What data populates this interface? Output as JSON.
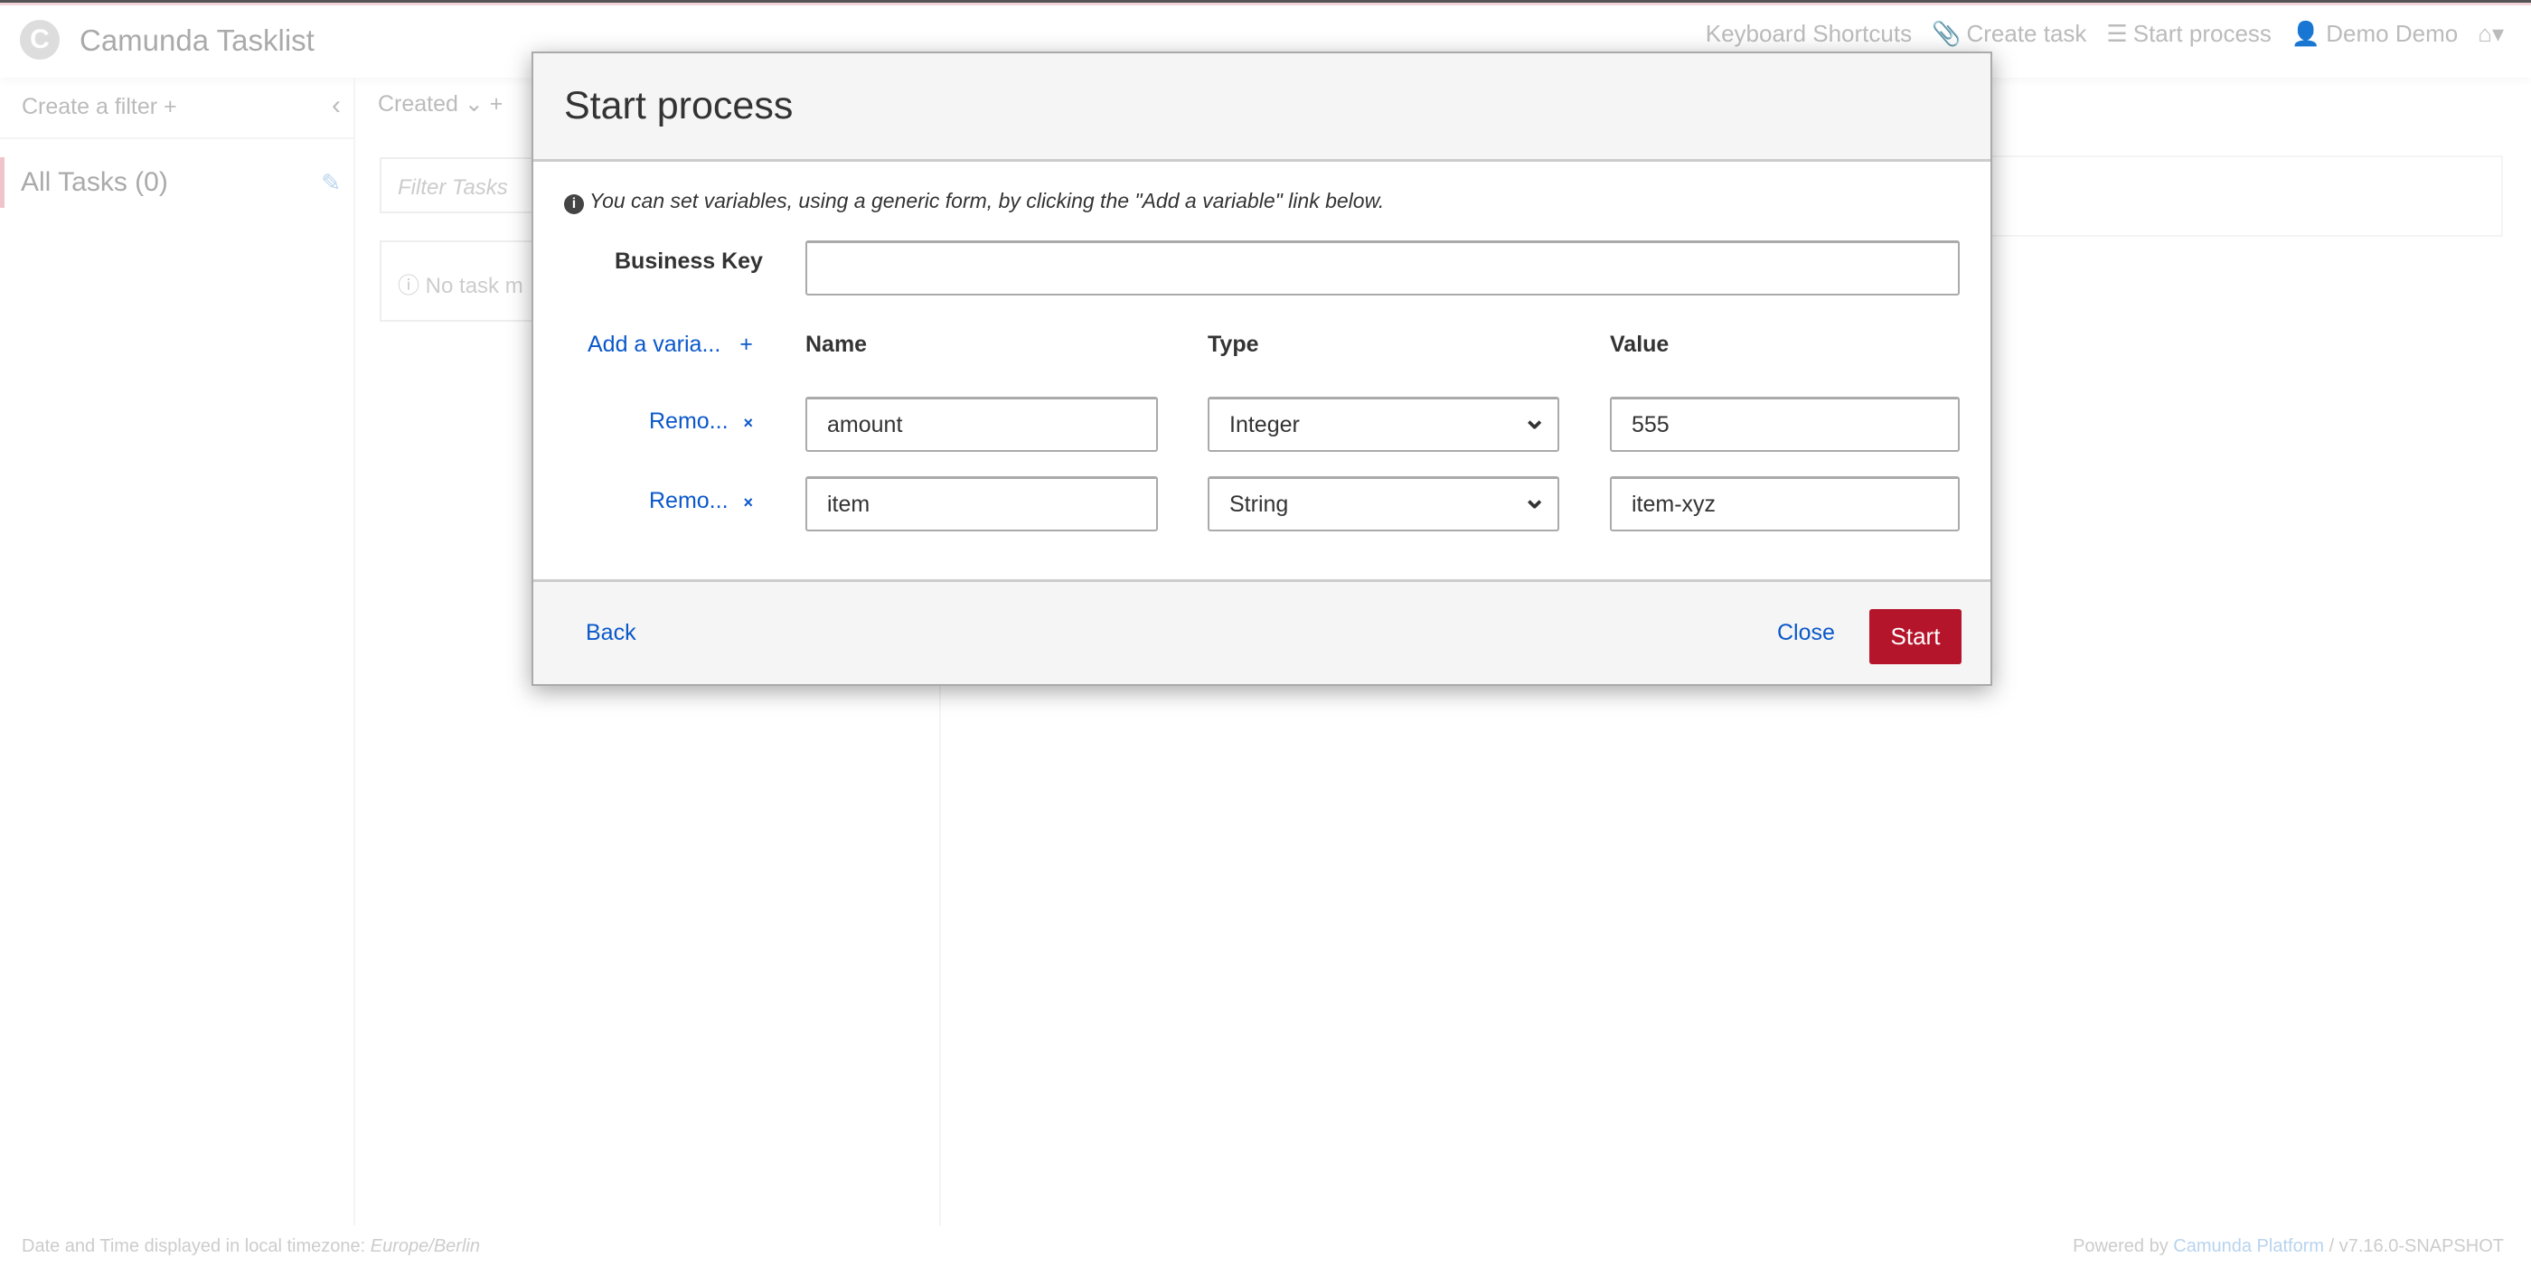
{
  "app": {
    "title": "Camunda Tasklist",
    "logo_letter": "C"
  },
  "nav": {
    "keyboard_shortcuts": "Keyboard Shortcuts",
    "create_task": "Create task",
    "start_process": "Start process",
    "user": "Demo Demo"
  },
  "sidebar": {
    "create_filter": "Create a filter +",
    "filter_name": "All Tasks",
    "filter_count": "(0)"
  },
  "list": {
    "sort": "Created",
    "add": "+",
    "search_placeholder": "Filter Tasks",
    "empty": "No task m"
  },
  "footer": {
    "timezone_label": "Date and Time displayed in local timezone:",
    "timezone": "Europe/Berlin",
    "powered_by": "Powered by",
    "platform": "Camunda Platform",
    "version": "/ v7.16.0-SNAPSHOT"
  },
  "modal": {
    "title": "Start process",
    "info": "You can set variables, using a generic form, by clicking the \"Add a variable\" link below.",
    "business_key_label": "Business Key",
    "business_key_value": "",
    "add_variable": "Add a varia...",
    "headers": {
      "name": "Name",
      "type": "Type",
      "value": "Value"
    },
    "variables": [
      {
        "remove": "Remo...",
        "name": "amount",
        "type": "Integer",
        "value": "555"
      },
      {
        "remove": "Remo...",
        "name": "item",
        "type": "String",
        "value": "item-xyz"
      }
    ],
    "back": "Back",
    "close": "Close",
    "start": "Start"
  },
  "colors": {
    "accent": "#b5152b",
    "link": "#0a58ca"
  }
}
